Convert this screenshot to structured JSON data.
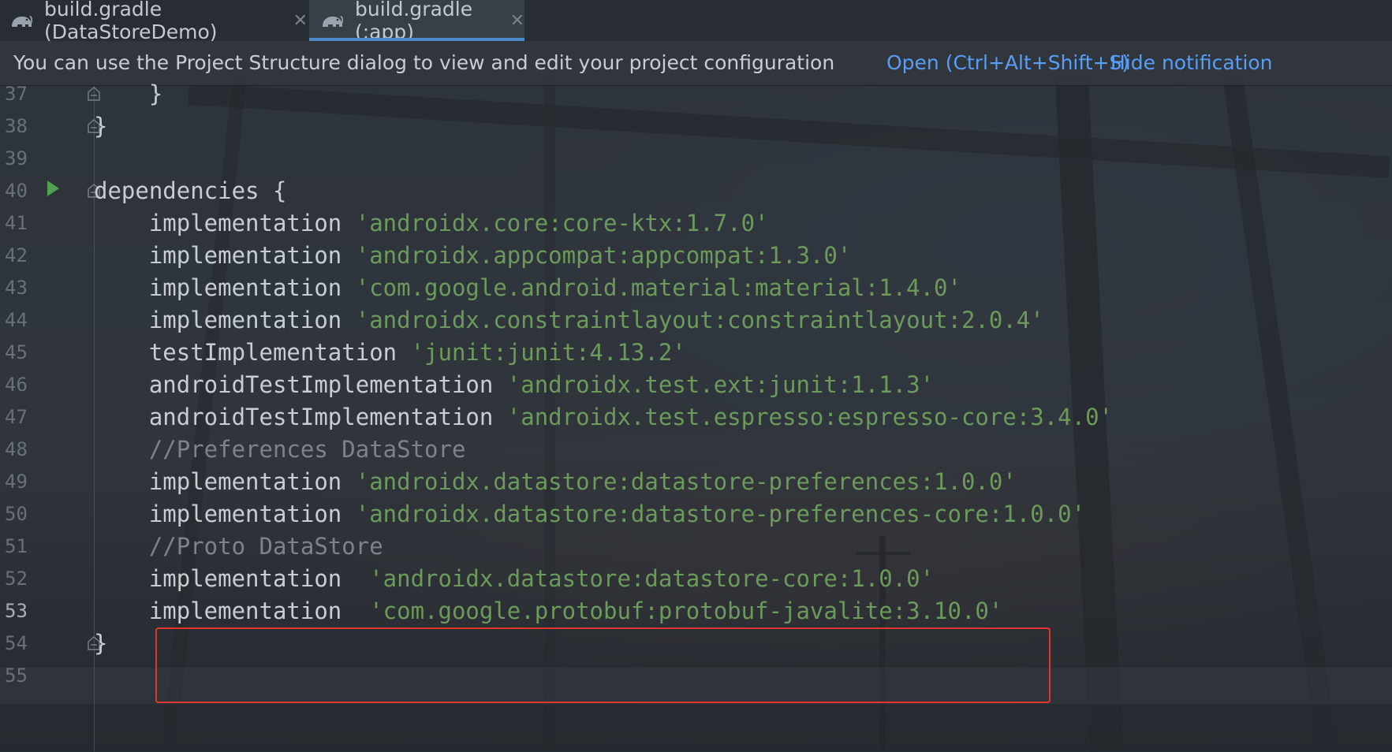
{
  "tabs": [
    {
      "label": "build.gradle (DataStoreDemo)",
      "active": false,
      "icon": "gradle-elephant-icon"
    },
    {
      "label": "build.gradle (:app)",
      "active": true,
      "icon": "gradle-elephant-icon"
    }
  ],
  "notification": {
    "message": "You can use the Project Structure dialog to view and edit your project configuration",
    "open_link": "Open (Ctrl+Alt+Shift+S)",
    "hide_link": "Hide notification"
  },
  "editor": {
    "lines": [
      {
        "num": "37",
        "parts": [
          {
            "t": "    }",
            "c": "kw"
          }
        ]
      },
      {
        "num": "38",
        "parts": [
          {
            "t": "}",
            "c": "kw"
          }
        ]
      },
      {
        "num": "39",
        "parts": []
      },
      {
        "num": "40",
        "parts": [
          {
            "t": "dependencies {",
            "c": "kw"
          }
        ]
      },
      {
        "num": "41",
        "parts": [
          {
            "t": "    implementation ",
            "c": "kw"
          },
          {
            "t": "'androidx.core:core-ktx:1.7.0'",
            "c": "str"
          }
        ]
      },
      {
        "num": "42",
        "parts": [
          {
            "t": "    implementation ",
            "c": "kw"
          },
          {
            "t": "'androidx.appcompat:appcompat:1.3.0'",
            "c": "str"
          }
        ]
      },
      {
        "num": "43",
        "parts": [
          {
            "t": "    implementation ",
            "c": "kw"
          },
          {
            "t": "'com.google.android.material:material:1.4.0'",
            "c": "str"
          }
        ]
      },
      {
        "num": "44",
        "parts": [
          {
            "t": "    implementation ",
            "c": "kw"
          },
          {
            "t": "'androidx.constraintlayout:constraintlayout:2.0.4'",
            "c": "str"
          }
        ]
      },
      {
        "num": "45",
        "parts": [
          {
            "t": "    testImplementation ",
            "c": "kw"
          },
          {
            "t": "'junit:junit:4.13.2'",
            "c": "str"
          }
        ]
      },
      {
        "num": "46",
        "parts": [
          {
            "t": "    androidTestImplementation ",
            "c": "kw"
          },
          {
            "t": "'androidx.test.ext:junit:1.1.3'",
            "c": "str"
          }
        ]
      },
      {
        "num": "47",
        "parts": [
          {
            "t": "    androidTestImplementation ",
            "c": "kw"
          },
          {
            "t": "'androidx.test.espresso:espresso-core:3.4.0'",
            "c": "str"
          }
        ]
      },
      {
        "num": "48",
        "parts": [
          {
            "t": "    //Preferences DataStore",
            "c": "cmt"
          }
        ]
      },
      {
        "num": "49",
        "parts": [
          {
            "t": "    implementation ",
            "c": "kw"
          },
          {
            "t": "'androidx.datastore:datastore-preferences:1.0.0'",
            "c": "str"
          }
        ]
      },
      {
        "num": "50",
        "parts": [
          {
            "t": "    implementation ",
            "c": "kw"
          },
          {
            "t": "'androidx.datastore:datastore-preferences-core:1.0.0'",
            "c": "str"
          }
        ]
      },
      {
        "num": "51",
        "parts": [
          {
            "t": "    //Proto DataStore",
            "c": "cmt"
          }
        ]
      },
      {
        "num": "52",
        "parts": [
          {
            "t": "    implementation  ",
            "c": "kw"
          },
          {
            "t": "'androidx.datastore:datastore-core:1.0.0'",
            "c": "str"
          }
        ]
      },
      {
        "num": "53",
        "parts": [
          {
            "t": "    implementation  ",
            "c": "kw"
          },
          {
            "t": "'com.google.protobuf:protobuf-javalite:3.10.0'",
            "c": "str"
          }
        ]
      },
      {
        "num": "54",
        "parts": [
          {
            "t": "}",
            "c": "kw"
          }
        ]
      },
      {
        "num": "55",
        "parts": []
      }
    ],
    "current_line": "53",
    "run_icon": "run-gutter-icon",
    "fold_icon": "fold-marker-icon"
  },
  "colors": {
    "string": "#6b9a5b",
    "comment": "#7e8389",
    "link": "#589df6",
    "highlight": "#e0342c",
    "tab_underline": "#4a88c7"
  }
}
